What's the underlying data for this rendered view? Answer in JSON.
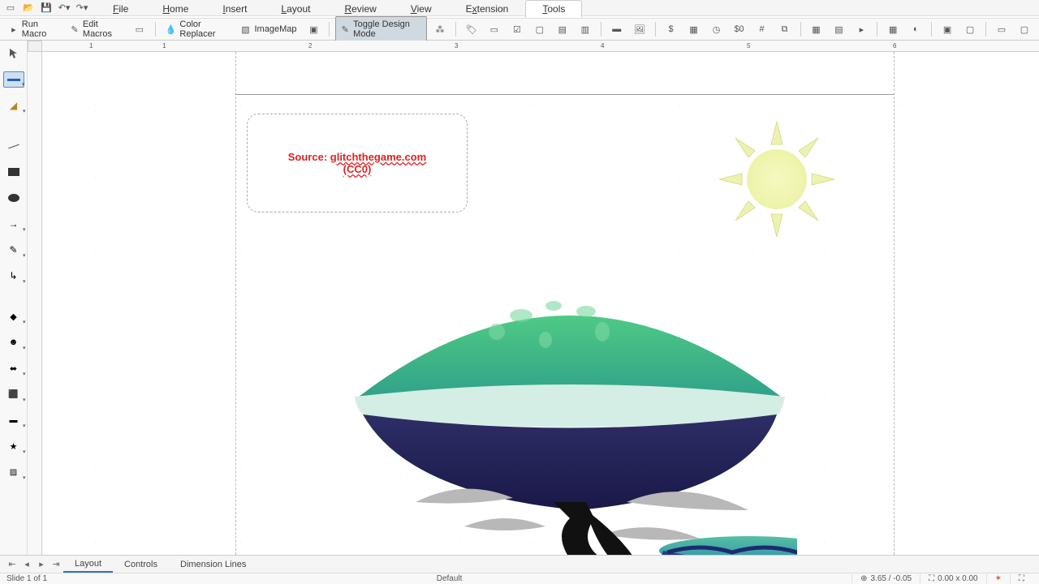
{
  "menu": {
    "file": "File",
    "home": "Home",
    "insert": "Insert",
    "layout": "Layout",
    "review": "Review",
    "view": "View",
    "extension": "Extension",
    "tools": "Tools"
  },
  "toolbar": {
    "run_macro": "Run Macro",
    "edit_macros": "Edit Macros",
    "color_replacer": "Color Replacer",
    "image_map": "ImageMap",
    "toggle_design": "Toggle Design Mode"
  },
  "ruler": {
    "marks": [
      "1",
      "1",
      "2",
      "3",
      "4",
      "5",
      "6"
    ]
  },
  "textbox": {
    "prefix": "Source: ",
    "url": "glitchthegame.com",
    "line2": "(CC0)"
  },
  "tabs": {
    "layout": "Layout",
    "controls": "Controls",
    "dimension": "Dimension Lines"
  },
  "status": {
    "slide": "Slide 1 of 1",
    "style": "Default",
    "coords": "3.65 / -0.05",
    "size": "0.00 x 0.00"
  }
}
